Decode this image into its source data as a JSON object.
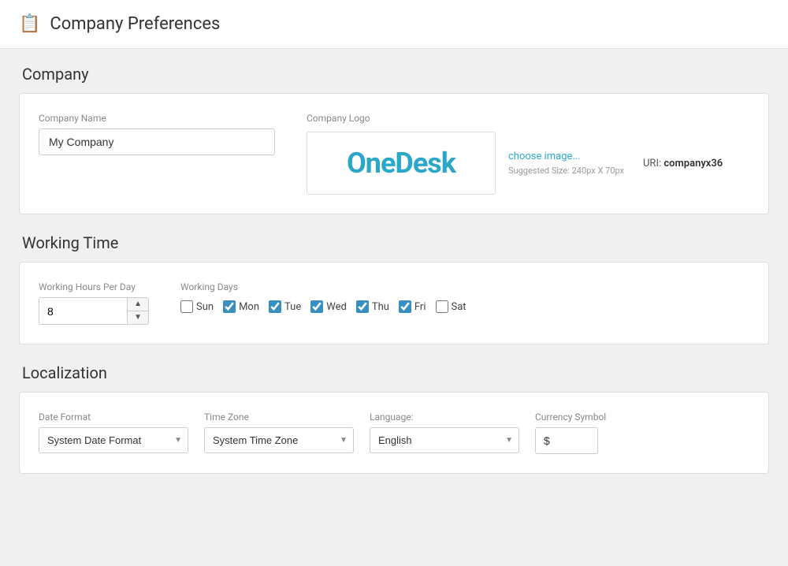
{
  "header": {
    "icon": "🗒",
    "title": "Company Preferences"
  },
  "sections": {
    "company": {
      "title": "Company",
      "fields": {
        "name_label": "Company Name",
        "name_value": "My Company",
        "logo_label": "Company Logo",
        "choose_image_text": "choose image...",
        "suggested_size": "Suggested Size: 240px X 70px",
        "uri_label": "URI:",
        "uri_value": "companyx36",
        "logo_display": "OneDesk"
      }
    },
    "working_time": {
      "title": "Working Time",
      "hours_label": "Working Hours Per Day",
      "hours_value": "8",
      "days_label": "Working Days",
      "days": [
        {
          "id": "sun",
          "label": "Sun",
          "checked": false
        },
        {
          "id": "mon",
          "label": "Mon",
          "checked": true
        },
        {
          "id": "tue",
          "label": "Tue",
          "checked": true
        },
        {
          "id": "wed",
          "label": "Wed",
          "checked": true
        },
        {
          "id": "thu",
          "label": "Thu",
          "checked": true
        },
        {
          "id": "fri",
          "label": "Fri",
          "checked": true
        },
        {
          "id": "sat",
          "label": "Sat",
          "checked": false
        }
      ]
    },
    "localization": {
      "title": "Localization",
      "date_format_label": "Date Format",
      "date_format_value": "System Date Format",
      "timezone_label": "Time Zone",
      "timezone_value": "System Time Zone",
      "language_label": "Language:",
      "language_value": "English",
      "currency_label": "Currency Symbol",
      "currency_value": "$"
    }
  }
}
